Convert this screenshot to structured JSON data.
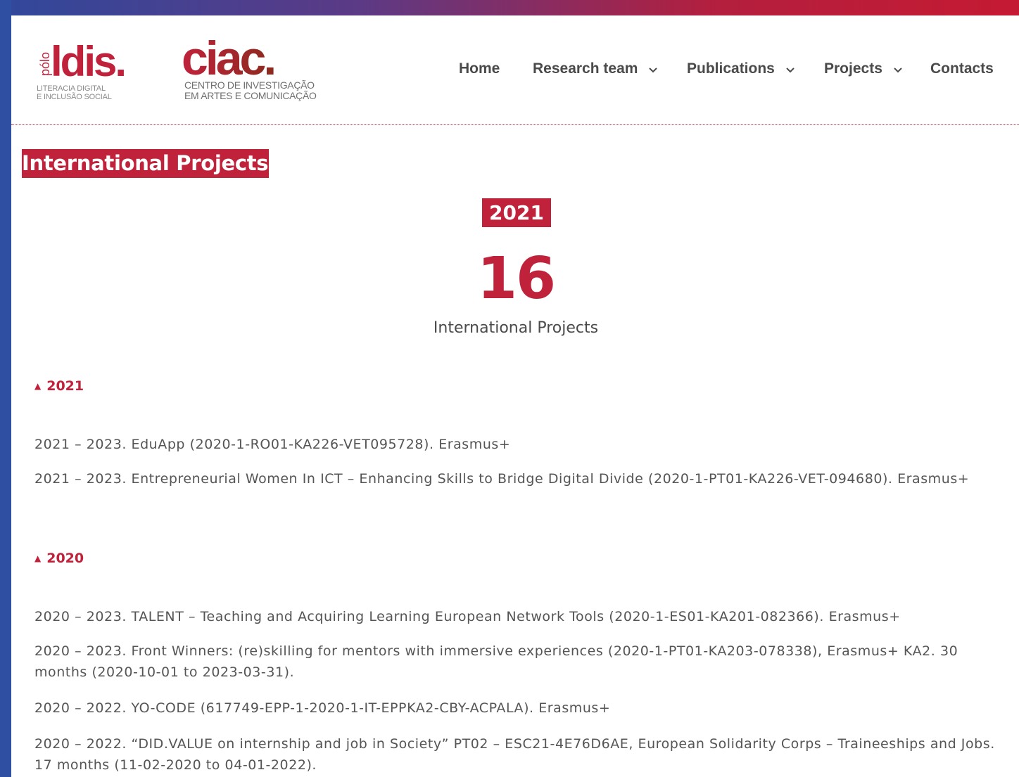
{
  "colors": {
    "brand_red": "#c0223b",
    "text": "#555555",
    "frame_blue": "#2f4fa2"
  },
  "logos": {
    "ldis": {
      "vertical_word": "pólo",
      "wordmark": "ldis.",
      "subtitle_line1": "LITERACIA DIGITAL",
      "subtitle_line2": "E INCLUSÃO SOCIAL"
    },
    "ciac": {
      "wordmark": "ciac.",
      "subtitle_line1": "CENTRO DE INVESTIGAÇÃO",
      "subtitle_line2": "EM ARTES E COMUNICAÇÃO"
    }
  },
  "nav": {
    "home": "Home",
    "research_team": "Research team",
    "publications": "Publications",
    "projects": "Projects",
    "contacts": "Contacts",
    "dropdown_icon": "chevron-down-icon"
  },
  "page_title": "International Projects",
  "stats": {
    "year": "2021",
    "count": "16",
    "label": "International Projects"
  },
  "groups": [
    {
      "year": "2021",
      "toggle_icon": "triangle-up-icon",
      "items": [
        "2021 – 2023. EduApp (2020-1-RO01-KA226-VET095728). Erasmus+",
        "2021 – 2023. Entrepreneurial Women In ICT – Enhancing Skills to Bridge Digital Divide (2020-1-PT01-KA226-VET-094680). Erasmus+"
      ]
    },
    {
      "year": "2020",
      "toggle_icon": "triangle-up-icon",
      "items": [
        "2020 – 2023. TALENT – Teaching and Acquiring Learning European Network Tools (2020-1-ES01-KA201-082366). Erasmus+",
        "2020 – 2023. Front Winners: (re)skilling for mentors with immersive experiences (2020-1-PT01-KA203-078338), Erasmus+ KA2. 30 months (2020-10-01 to 2023-03-31).",
        "2020 – 2022. YO-CODE (617749-EPP-1-2020-1-IT-EPPKA2-CBY-ACPALA). Erasmus+",
        "2020 – 2022. “DID.VALUE on internship and job in Society” PT02 – ESC21-4E76D6AE, European Solidarity Corps – Traineeships and Jobs. 17 months (11-02-2020 to 04-01-2022)."
      ]
    }
  ]
}
